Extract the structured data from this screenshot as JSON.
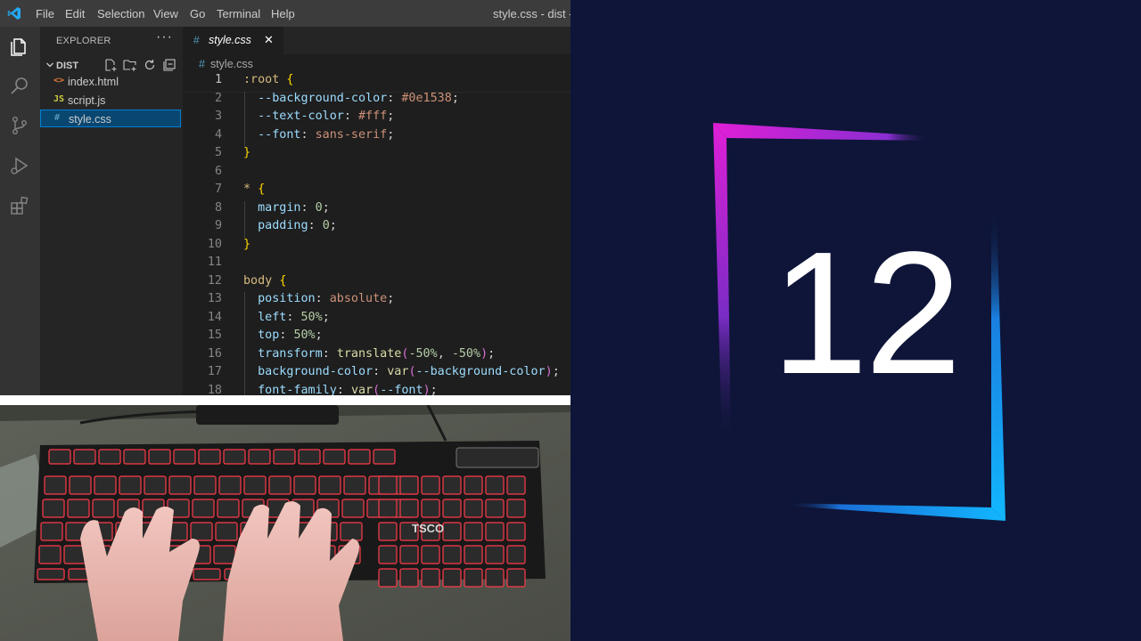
{
  "titlebar": {
    "menu": [
      "File",
      "Edit",
      "Selection",
      "View",
      "Go",
      "Terminal",
      "Help"
    ],
    "window_title": "style.css - dist - Vi"
  },
  "activity_bar": {
    "icons": [
      "explorer-icon",
      "search-icon",
      "source-control-icon",
      "run-debug-icon",
      "extensions-icon"
    ]
  },
  "sidebar": {
    "title": "EXPLORER",
    "more": "···",
    "folder": "DIST",
    "files": [
      {
        "icon": "<>",
        "icon_color": "#e37933",
        "name": "index.html"
      },
      {
        "icon": "JS",
        "icon_color": "#cbcb41",
        "name": "script.js"
      },
      {
        "icon": "#",
        "icon_color": "#519aba",
        "name": "style.css"
      }
    ]
  },
  "editor": {
    "tab_label": "style.css",
    "tab_icon": "#",
    "tab_close": "✕",
    "breadcrumb": "style.css",
    "current_line": 1,
    "lines": [
      [
        [
          "t-sel",
          ":root"
        ],
        [
          "t-punc",
          " "
        ],
        [
          "t-brace",
          "{"
        ]
      ],
      [
        [
          "t-punc",
          "  "
        ],
        [
          "t-prop",
          "--background-color"
        ],
        [
          "t-punc",
          ": "
        ],
        [
          "t-str",
          "#0e1538"
        ],
        [
          "t-punc",
          ";"
        ]
      ],
      [
        [
          "t-punc",
          "  "
        ],
        [
          "t-prop",
          "--text-color"
        ],
        [
          "t-punc",
          ": "
        ],
        [
          "t-str",
          "#fff"
        ],
        [
          "t-punc",
          ";"
        ]
      ],
      [
        [
          "t-punc",
          "  "
        ],
        [
          "t-prop",
          "--font"
        ],
        [
          "t-punc",
          ": "
        ],
        [
          "t-str",
          "sans-serif"
        ],
        [
          "t-punc",
          ";"
        ]
      ],
      [
        [
          "t-brace",
          "}"
        ]
      ],
      [],
      [
        [
          "t-tag",
          "*"
        ],
        [
          "t-punc",
          " "
        ],
        [
          "t-brace",
          "{"
        ]
      ],
      [
        [
          "t-punc",
          "  "
        ],
        [
          "t-prop",
          "margin"
        ],
        [
          "t-punc",
          ": "
        ],
        [
          "t-num",
          "0"
        ],
        [
          "t-punc",
          ";"
        ]
      ],
      [
        [
          "t-punc",
          "  "
        ],
        [
          "t-prop",
          "padding"
        ],
        [
          "t-punc",
          ": "
        ],
        [
          "t-num",
          "0"
        ],
        [
          "t-punc",
          ";"
        ]
      ],
      [
        [
          "t-brace",
          "}"
        ]
      ],
      [],
      [
        [
          "t-tag",
          "body"
        ],
        [
          "t-punc",
          " "
        ],
        [
          "t-brace",
          "{"
        ]
      ],
      [
        [
          "t-punc",
          "  "
        ],
        [
          "t-prop",
          "position"
        ],
        [
          "t-punc",
          ": "
        ],
        [
          "t-str",
          "absolute"
        ],
        [
          "t-punc",
          ";"
        ]
      ],
      [
        [
          "t-punc",
          "  "
        ],
        [
          "t-prop",
          "left"
        ],
        [
          "t-punc",
          ": "
        ],
        [
          "t-num",
          "50%"
        ],
        [
          "t-punc",
          ";"
        ]
      ],
      [
        [
          "t-punc",
          "  "
        ],
        [
          "t-prop",
          "top"
        ],
        [
          "t-punc",
          ": "
        ],
        [
          "t-num",
          "50%"
        ],
        [
          "t-punc",
          ";"
        ]
      ],
      [
        [
          "t-punc",
          "  "
        ],
        [
          "t-prop",
          "transform"
        ],
        [
          "t-punc",
          ": "
        ],
        [
          "t-fn",
          "translate"
        ],
        [
          "t-paren",
          "("
        ],
        [
          "t-num",
          "-50%"
        ],
        [
          "t-punc",
          ", "
        ],
        [
          "t-num",
          "-50%"
        ],
        [
          "t-paren",
          ")"
        ],
        [
          "t-punc",
          ";"
        ]
      ],
      [
        [
          "t-punc",
          "  "
        ],
        [
          "t-prop",
          "background-color"
        ],
        [
          "t-punc",
          ": "
        ],
        [
          "t-fn",
          "var"
        ],
        [
          "t-paren",
          "("
        ],
        [
          "t-prop",
          "--background-color"
        ],
        [
          "t-paren",
          ")"
        ],
        [
          "t-punc",
          ";"
        ]
      ],
      [
        [
          "t-punc",
          "  "
        ],
        [
          "t-prop",
          "font-family"
        ],
        [
          "t-punc",
          ": "
        ],
        [
          "t-fn",
          "var"
        ],
        [
          "t-paren",
          "("
        ],
        [
          "t-prop",
          "--font"
        ],
        [
          "t-paren",
          ")"
        ],
        [
          "t-punc",
          ";"
        ]
      ]
    ]
  },
  "webcam": {
    "keyboard_brand": "TSCO"
  },
  "preview": {
    "counter_value": "12",
    "background_color": "#0e1538",
    "gradient_start": "#e01fd6",
    "gradient_end": "#12b7ff"
  },
  "colors": {
    "titlebar": "#3c3c3c",
    "activity_bar": "#333333",
    "sidebar": "#252526",
    "editor_bg": "#1e1e1e",
    "selection": "#094771"
  }
}
